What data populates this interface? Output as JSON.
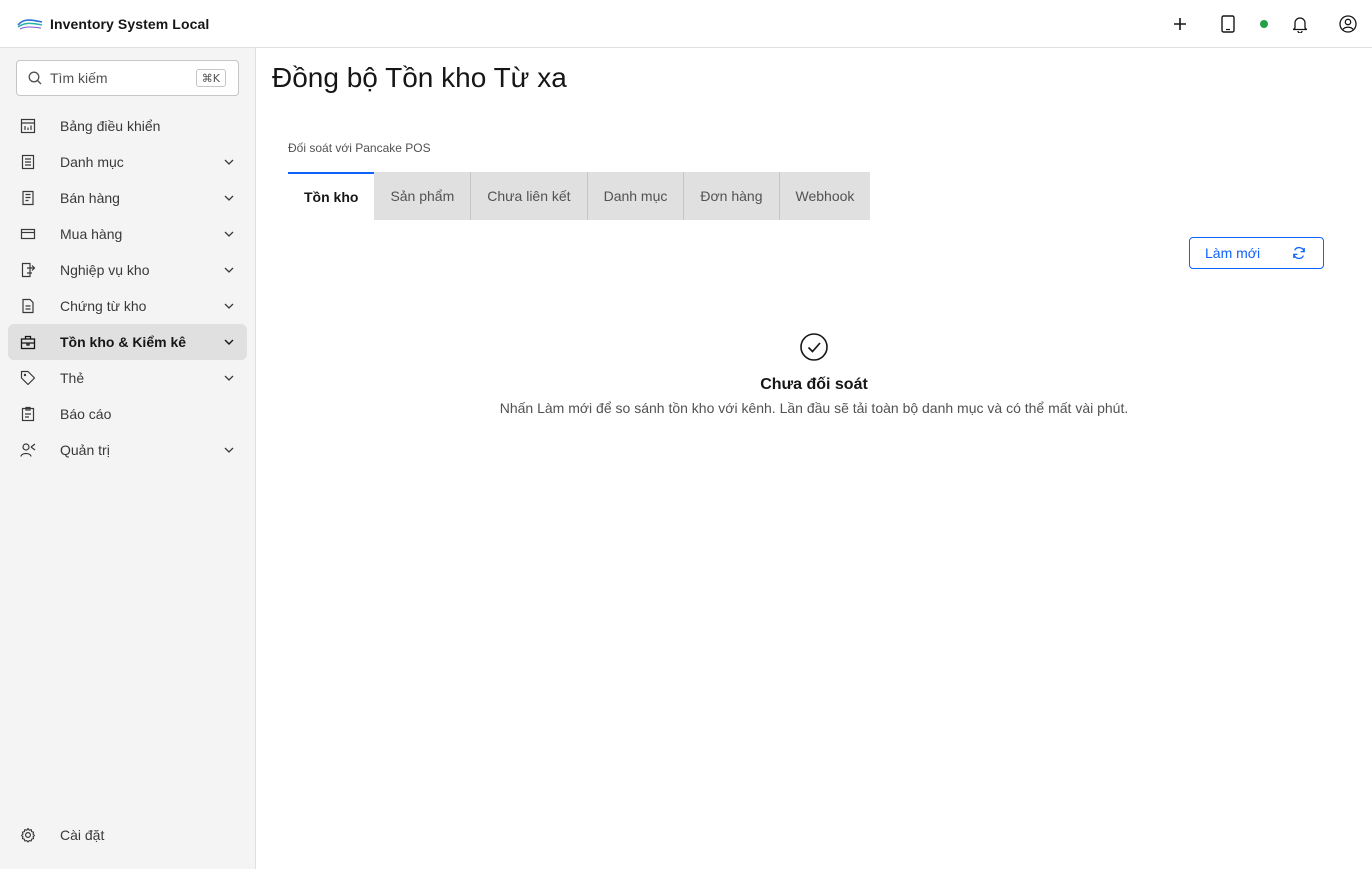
{
  "app": {
    "title": "Inventory System Local"
  },
  "header": {
    "status_color": "#24a148",
    "actions": [
      "plus-icon",
      "tablet-icon",
      "status-dot",
      "bell-icon",
      "user-avatar-icon"
    ]
  },
  "sidebar": {
    "search": {
      "placeholder": "Tìm kiếm",
      "shortcut": "⌘K"
    },
    "items": [
      {
        "label": "Bảng điều khiển",
        "icon": "dashboard-icon",
        "expandable": false,
        "active": false
      },
      {
        "label": "Danh mục",
        "icon": "catalog-icon",
        "expandable": true,
        "active": false
      },
      {
        "label": "Bán hàng",
        "icon": "receipt-icon",
        "expandable": true,
        "active": false
      },
      {
        "label": "Mua hàng",
        "icon": "credit-card-icon",
        "expandable": true,
        "active": false
      },
      {
        "label": "Nghiệp vụ kho",
        "icon": "warehouse-transfer-icon",
        "expandable": true,
        "active": false
      },
      {
        "label": "Chứng từ kho",
        "icon": "document-icon",
        "expandable": true,
        "active": false
      },
      {
        "label": "Tồn kho & Kiểm kê",
        "icon": "inventory-icon",
        "expandable": true,
        "active": true
      },
      {
        "label": "Thẻ",
        "icon": "tag-icon",
        "expandable": true,
        "active": false
      },
      {
        "label": "Báo cáo",
        "icon": "report-icon",
        "expandable": false,
        "active": false
      },
      {
        "label": "Quản trị",
        "icon": "admin-user-icon",
        "expandable": true,
        "active": false
      }
    ],
    "settings_label": "Cài đặt"
  },
  "main": {
    "page_title": "Đồng bộ Tồn kho Từ xa",
    "subtitle": "Đối soát với Pancake POS",
    "tabs": [
      {
        "label": "Tồn kho",
        "active": true
      },
      {
        "label": "Sản phẩm",
        "active": false
      },
      {
        "label": "Chưa liên kết",
        "active": false
      },
      {
        "label": "Danh mục",
        "active": false
      },
      {
        "label": "Đơn hàng",
        "active": false
      },
      {
        "label": "Webhook",
        "active": false
      }
    ],
    "refresh_label": "Làm mới",
    "accent_color": "#0f62fe",
    "empty_state": {
      "title": "Chưa đối soát",
      "description": "Nhấn Làm mới để so sánh tồn kho với kênh. Lần đầu sẽ tải toàn bộ danh mục và có thể mất vài phút."
    }
  }
}
